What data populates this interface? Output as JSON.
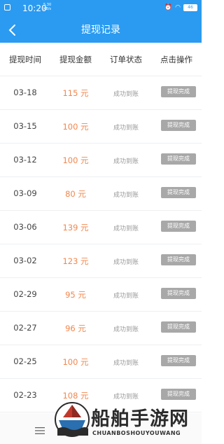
{
  "status": {
    "time": "10:20",
    "speed": "5.30\nKB/s",
    "battery": "46"
  },
  "header": {
    "title": "提现记录"
  },
  "columns": [
    "提现时间",
    "提现金额",
    "订单状态",
    "点击操作"
  ],
  "rows": [
    {
      "date": "03-18",
      "amount": "115 元",
      "status": "成功到账",
      "action": "提现完成"
    },
    {
      "date": "03-15",
      "amount": "100 元",
      "status": "成功到账",
      "action": "提现完成"
    },
    {
      "date": "03-12",
      "amount": "100 元",
      "status": "成功到账",
      "action": "提现完成"
    },
    {
      "date": "03-09",
      "amount": "80 元",
      "status": "成功到账",
      "action": "提现完成"
    },
    {
      "date": "03-06",
      "amount": "139 元",
      "status": "成功到账",
      "action": "提现完成"
    },
    {
      "date": "03-02",
      "amount": "123 元",
      "status": "成功到账",
      "action": "提现完成"
    },
    {
      "date": "02-29",
      "amount": "95 元",
      "status": "成功到账",
      "action": "提现完成"
    },
    {
      "date": "02-27",
      "amount": "96 元",
      "status": "成功到账",
      "action": "提现完成"
    },
    {
      "date": "02-25",
      "amount": "100 元",
      "status": "成功到账",
      "action": "提现完成"
    },
    {
      "date": "02-23",
      "amount": "108 元",
      "status": "成功到账",
      "action": "提现完成"
    }
  ],
  "watermark": {
    "title": "船舶手游网",
    "subtitle": "CHUANBOSHOUYOUWANG"
  },
  "colors": {
    "header": "#2a9bf1",
    "amount": "#f0874e",
    "button": "#a8a8a8"
  }
}
